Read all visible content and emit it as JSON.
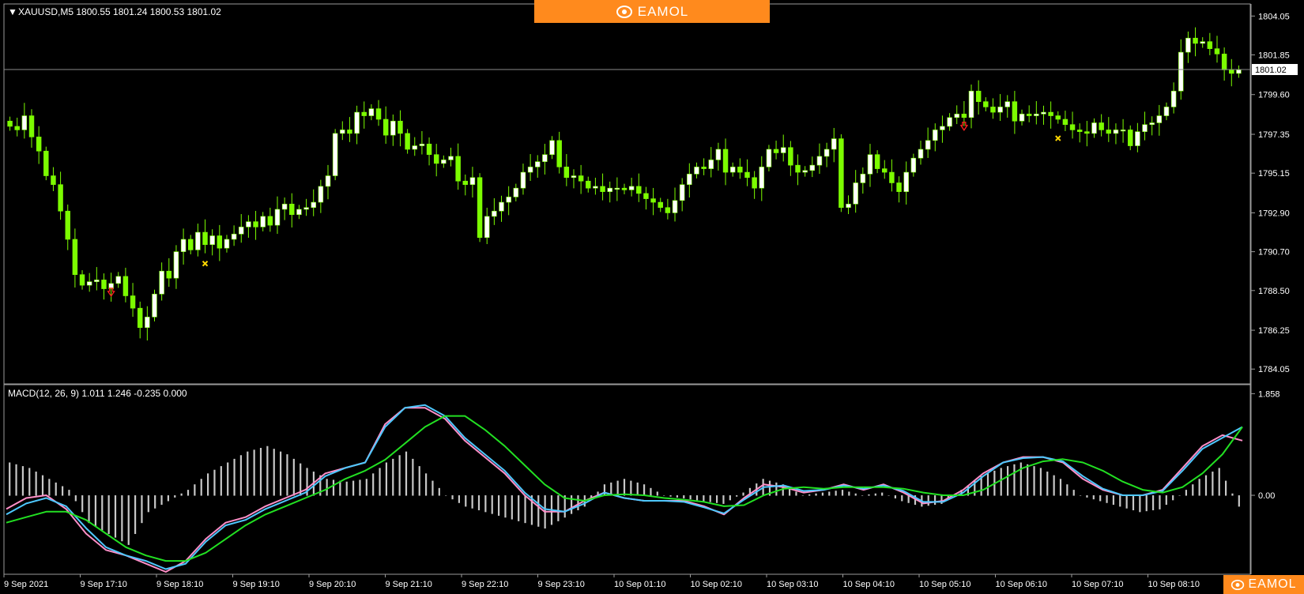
{
  "price_header": {
    "arrow": "▼",
    "text": "XAUUSD,M5  1800.55 1801.24 1800.53 1801.02"
  },
  "macd_header": {
    "text": "MACD(12, 26, 9) 1.011 1.246 -0.235 0.000"
  },
  "brand": {
    "text": "EAMOL",
    "logo_icon": "eye-logo-icon",
    "color": "#ff8a1d"
  },
  "colors": {
    "bull_candle_body": "#ffffff",
    "bear_candle_body": "#7CFC00",
    "wick": "#7CFC00",
    "macd_line": "#4ec8ff",
    "macd_signal_pink": "#ff8fc8",
    "macd_signal_green": "#22e022",
    "histogram": "#c8c8c8",
    "current_price_line": "#8a8a8a",
    "arrow_down_icon": "#ff2020",
    "cross_icon": "#ffd700"
  },
  "chart_data": [
    {
      "type": "candlestick",
      "symbol": "XAUUSD",
      "timeframe": "M5",
      "ohlc_last": {
        "open": 1800.55,
        "high": 1801.24,
        "low": 1800.53,
        "close": 1801.02
      },
      "current_price": 1801.02,
      "current_price_label": "1801.02",
      "ylim": [
        1783.3,
        1804.6
      ],
      "y_ticks": [
        "1804.05",
        "1801.85",
        "1799.60",
        "1797.35",
        "1795.15",
        "1792.90",
        "1790.70",
        "1788.50",
        "1786.25",
        "1784.05"
      ],
      "x_ticks": [
        "9 Sep 2021",
        "9 Sep 17:10",
        "9 Sep 18:10",
        "9 Sep 19:10",
        "9 Sep 20:10",
        "9 Sep 21:10",
        "9 Sep 22:10",
        "9 Sep 23:10",
        "10 Sep 01:10",
        "10 Sep 02:10",
        "10 Sep 03:10",
        "10 Sep 04:10",
        "10 Sep 05:10",
        "10 Sep 06:10",
        "10 Sep 07:10",
        "10 Sep 08:10"
      ],
      "closes": [
        1797.8,
        1797.6,
        1798.4,
        1797.2,
        1796.4,
        1795.0,
        1794.5,
        1793.0,
        1791.4,
        1789.4,
        1788.8,
        1789.0,
        1789.1,
        1788.6,
        1788.9,
        1789.3,
        1788.2,
        1787.5,
        1786.4,
        1787.0,
        1788.3,
        1789.6,
        1789.2,
        1790.7,
        1791.4,
        1790.8,
        1791.8,
        1791.1,
        1791.6,
        1790.9,
        1791.4,
        1791.7,
        1792.1,
        1792.4,
        1792.1,
        1792.7,
        1792.2,
        1793.1,
        1793.4,
        1792.8,
        1793.1,
        1793.2,
        1793.5,
        1794.4,
        1795.0,
        1797.4,
        1797.6,
        1797.4,
        1798.6,
        1798.4,
        1798.8,
        1798.2,
        1797.3,
        1798.1,
        1797.4,
        1796.5,
        1796.7,
        1796.8,
        1796.2,
        1795.7,
        1795.9,
        1796.1,
        1794.7,
        1794.5,
        1794.9,
        1791.5,
        1792.7,
        1793.0,
        1793.5,
        1793.8,
        1794.3,
        1795.2,
        1795.5,
        1795.8,
        1796.2,
        1797.0,
        1795.5,
        1794.9,
        1795.0,
        1794.7,
        1794.3,
        1794.4,
        1794.1,
        1794.3,
        1794.3,
        1794.2,
        1794.4,
        1794.0,
        1793.7,
        1793.5,
        1793.2,
        1792.9,
        1793.6,
        1794.5,
        1795.1,
        1795.5,
        1795.4,
        1795.9,
        1796.5,
        1795.2,
        1795.5,
        1795.2,
        1794.9,
        1794.3,
        1795.5,
        1796.5,
        1796.3,
        1796.6,
        1795.6,
        1795.2,
        1795.3,
        1795.6,
        1796.1,
        1796.5,
        1797.1,
        1793.2,
        1793.4,
        1794.6,
        1795.1,
        1796.2,
        1795.4,
        1795.2,
        1794.6,
        1794.1,
        1795.2,
        1796.0,
        1796.5,
        1797.0,
        1797.6,
        1797.8,
        1798.3,
        1798.5,
        1798.3,
        1799.8,
        1799.2,
        1798.9,
        1798.6,
        1798.9,
        1799.2,
        1798.1,
        1798.5,
        1798.4,
        1798.5,
        1798.6,
        1798.4,
        1798.2,
        1797.9,
        1797.6,
        1797.5,
        1797.4,
        1798.0,
        1797.6,
        1797.4,
        1797.6,
        1797.6,
        1796.7,
        1797.5,
        1797.9,
        1798.0,
        1798.4,
        1798.9,
        1799.8,
        1802.0,
        1802.8,
        1802.5,
        1802.6,
        1802.2,
        1801.9,
        1801.0,
        1800.8,
        1801.0
      ],
      "markers": [
        {
          "type": "arrow-down-icon",
          "at": 5
        },
        {
          "type": "cross-icon",
          "at": 10
        },
        {
          "type": "arrow-down-icon",
          "at": 48
        },
        {
          "type": "cross-icon",
          "at": 53
        },
        {
          "type": "arrow-down-icon",
          "at": 72
        },
        {
          "type": "cross-icon",
          "at": 75
        },
        {
          "type": "arrow-down-icon",
          "at": 96
        },
        {
          "type": "cross-icon",
          "at": 98
        },
        {
          "type": "arrow-down-icon",
          "at": 104
        },
        {
          "type": "cross-icon",
          "at": 106
        },
        {
          "type": "arrow-down-icon",
          "at": 110
        },
        {
          "type": "cross-icon",
          "at": 112
        },
        {
          "type": "arrow-down-icon",
          "at": 134
        },
        {
          "type": "cross-icon",
          "at": 142
        },
        {
          "type": "arrow-down-icon",
          "at": 160
        }
      ]
    },
    {
      "type": "line",
      "indicator": "MACD",
      "params": [
        12,
        26,
        9
      ],
      "values": {
        "main": 1.011,
        "signal": 1.246,
        "histogram": -0.235,
        "level": 0.0
      },
      "ylim": [
        -1.4,
        1.95
      ],
      "y_ticks": [
        "1.858",
        "0.00"
      ],
      "series": [
        {
          "values": [
            -0.25,
            -0.05,
            0.0,
            -0.25,
            -0.7,
            -1.0,
            -1.1,
            -1.25,
            -1.4,
            -1.2,
            -0.8,
            -0.5,
            -0.4,
            -0.2,
            -0.05,
            0.1,
            0.4,
            0.5,
            0.6,
            1.3,
            1.6,
            1.6,
            1.4,
            1.0,
            0.7,
            0.4,
            0.0,
            -0.3,
            -0.3,
            -0.1,
            0.05,
            -0.05,
            -0.1,
            -0.1,
            -0.1,
            -0.2,
            -0.35,
            -0.05,
            0.2,
            0.15,
            0.05,
            0.1,
            0.2,
            0.1,
            0.2,
            0.05,
            -0.15,
            -0.1,
            0.1,
            0.4,
            0.6,
            0.7,
            0.7,
            0.6,
            0.3,
            0.1,
            0.0,
            0.0,
            0.1,
            0.5,
            0.9,
            1.1,
            1.0
          ]
        },
        {
          "values": [
            -0.35,
            -0.15,
            -0.05,
            -0.2,
            -0.6,
            -0.95,
            -1.1,
            -1.2,
            -1.35,
            -1.25,
            -0.85,
            -0.55,
            -0.45,
            -0.25,
            -0.1,
            0.05,
            0.35,
            0.5,
            0.6,
            1.25,
            1.6,
            1.65,
            1.45,
            1.05,
            0.75,
            0.45,
            0.05,
            -0.25,
            -0.3,
            -0.15,
            0.05,
            -0.05,
            -0.1,
            -0.1,
            -0.12,
            -0.22,
            -0.33,
            -0.08,
            0.15,
            0.18,
            0.08,
            0.1,
            0.18,
            0.12,
            0.18,
            0.08,
            -0.12,
            -0.12,
            0.05,
            0.35,
            0.6,
            0.68,
            0.7,
            0.62,
            0.35,
            0.12,
            0.0,
            0.0,
            0.08,
            0.45,
            0.85,
            1.05,
            1.25
          ]
        },
        {
          "values": [
            -0.5,
            -0.4,
            -0.3,
            -0.3,
            -0.45,
            -0.7,
            -0.95,
            -1.1,
            -1.2,
            -1.2,
            -1.05,
            -0.8,
            -0.55,
            -0.35,
            -0.2,
            -0.05,
            0.1,
            0.3,
            0.45,
            0.65,
            0.95,
            1.25,
            1.45,
            1.45,
            1.2,
            0.9,
            0.55,
            0.2,
            -0.05,
            -0.1,
            0.0,
            0.02,
            0.0,
            -0.05,
            -0.08,
            -0.12,
            -0.2,
            -0.18,
            0.0,
            0.12,
            0.15,
            0.12,
            0.15,
            0.15,
            0.15,
            0.12,
            0.05,
            0.0,
            0.0,
            0.1,
            0.3,
            0.5,
            0.62,
            0.66,
            0.6,
            0.45,
            0.25,
            0.1,
            0.05,
            0.15,
            0.4,
            0.75,
            1.25
          ]
        }
      ],
      "histogram": [
        0.6,
        0.5,
        0.3,
        0.1,
        -0.5,
        -0.7,
        -0.9,
        -0.3,
        -0.1,
        0.1,
        0.4,
        0.6,
        0.8,
        0.9,
        0.75,
        0.5,
        0.3,
        0.25,
        0.3,
        0.6,
        0.8,
        0.4,
        0.0,
        -0.2,
        -0.3,
        -0.4,
        -0.5,
        -0.6,
        -0.4,
        -0.2,
        0.2,
        0.3,
        0.2,
        0.0,
        -0.05,
        -0.1,
        -0.15,
        0.05,
        0.3,
        0.2,
        0.0,
        0.05,
        0.1,
        0.0,
        0.05,
        -0.1,
        -0.2,
        -0.15,
        0.1,
        0.35,
        0.5,
        0.6,
        0.5,
        0.3,
        0.0,
        -0.1,
        -0.2,
        -0.3,
        -0.25,
        0.0,
        0.3,
        0.5,
        -0.2
      ]
    }
  ]
}
